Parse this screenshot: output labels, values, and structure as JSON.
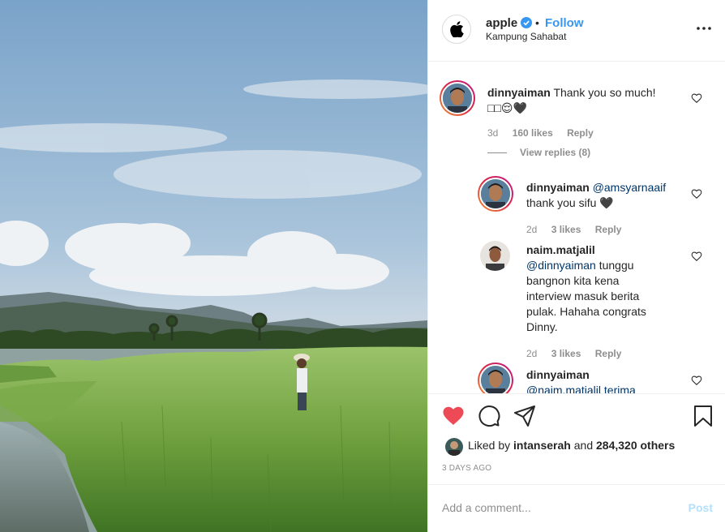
{
  "post": {
    "author": "apple",
    "follow_label": "Follow",
    "separator": "•",
    "location": "Kampung Sahabat",
    "brand_colors": {
      "accent": "#3897f0",
      "like": "#ed4956",
      "mention": "#003569"
    }
  },
  "comments": [
    {
      "user": "dinnyaiman",
      "text": "Thank you so much!",
      "text_line2": "□□😌🖤",
      "age": "3d",
      "likes": "160 likes",
      "reply": "Reply",
      "view_replies": "View replies (8)"
    }
  ],
  "replies": [
    {
      "user": "dinnyaiman",
      "mention": "@amsyarnaaif",
      "text": "thank you sifu 🖤",
      "age": "2d",
      "likes": "3 likes",
      "reply": "Reply"
    },
    {
      "user": "naim.matjalil",
      "mention": "@dinnyaiman",
      "text_1": " tunggu",
      "text_2": "bangnon kita kena",
      "text_3": "interview masuk berita",
      "text_4": "pulak. Hahaha congrats",
      "text_5": "Dinny.",
      "age": "2d",
      "likes": "3 likes",
      "reply": "Reply"
    },
    {
      "user": "dinnyaiman",
      "mention_cut": "@naim.matjalil terima"
    }
  ],
  "actions": {
    "liked_by_prefix": "Liked by ",
    "liked_by_user": "intanserah",
    "liked_by_suffix": " and ",
    "others": "284,320 others",
    "time_ago": "3 DAYS AGO",
    "icons": [
      "heart-filled-icon",
      "comment-icon",
      "share-icon",
      "bookmark-icon"
    ]
  },
  "add_comment": {
    "placeholder": "Add a comment...",
    "post_label": "Post"
  }
}
